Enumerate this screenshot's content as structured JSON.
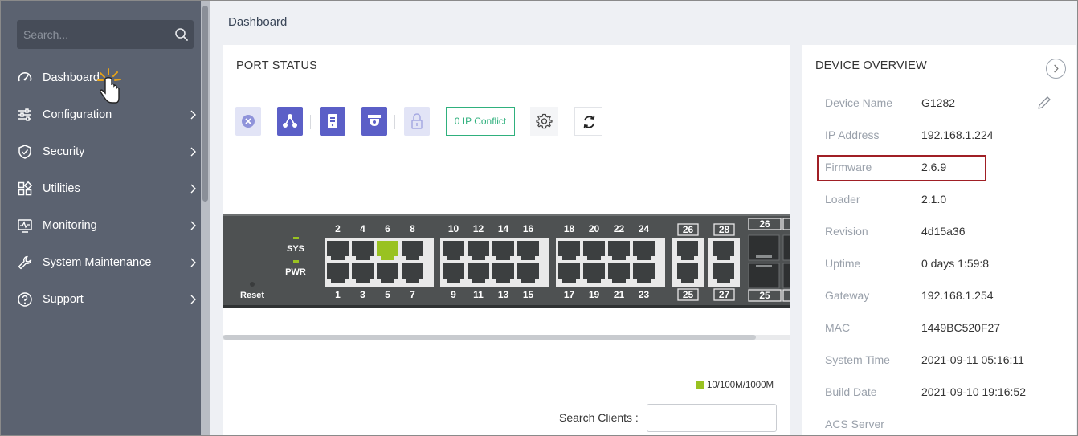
{
  "search": {
    "placeholder": "Search..."
  },
  "nav": [
    {
      "label": "Dashboard",
      "icon": "gauge-icon",
      "has_submenu": false
    },
    {
      "label": "Configuration",
      "icon": "sliders-icon",
      "has_submenu": true
    },
    {
      "label": "Security",
      "icon": "shield-icon",
      "has_submenu": true
    },
    {
      "label": "Utilities",
      "icon": "grid-icon",
      "has_submenu": true
    },
    {
      "label": "Monitoring",
      "icon": "monitor-icon",
      "has_submenu": true
    },
    {
      "label": "System Maintenance",
      "icon": "wrench-icon",
      "has_submenu": true
    },
    {
      "label": "Support",
      "icon": "help-circle-icon",
      "has_submenu": true
    }
  ],
  "breadcrumb": "Dashboard",
  "port_status": {
    "title": "PORT STATUS",
    "toolbar": {
      "ip_conflict_label": "0 IP Conflict"
    },
    "switch": {
      "sys_label": "SYS",
      "pwr_label": "PWR",
      "reset_label": "Reset",
      "top_port_numbers": [
        "2",
        "4",
        "6",
        "8",
        "10",
        "12",
        "14",
        "16",
        "18",
        "20",
        "22",
        "24"
      ],
      "bottom_port_numbers": [
        "1",
        "3",
        "5",
        "7",
        "9",
        "11",
        "13",
        "15",
        "17",
        "19",
        "21",
        "23"
      ],
      "extra_top": [
        "26",
        "28"
      ],
      "extra_bottom": [
        "25",
        "27"
      ],
      "sfp_top": "26",
      "sfp_bottom": "25",
      "active_port": "6"
    },
    "legend_label": "10/100M/1000M",
    "search_clients_label": "Search Clients :"
  },
  "device_overview": {
    "title": "DEVICE OVERVIEW",
    "rows": [
      {
        "key": "Device Name",
        "value": "G1282"
      },
      {
        "key": "IP Address",
        "value": "192.168.1.224"
      },
      {
        "key": "Firmware",
        "value": "2.6.9"
      },
      {
        "key": "Loader",
        "value": "2.1.0"
      },
      {
        "key": "Revision",
        "value": "4d15a36"
      },
      {
        "key": "Uptime",
        "value": "0 days 1:59:8"
      },
      {
        "key": "Gateway",
        "value": "192.168.1.254"
      },
      {
        "key": "MAC",
        "value": "1449BC520F27"
      },
      {
        "key": "System Time",
        "value": "2021-09-11 05:16:11"
      },
      {
        "key": "Build Date",
        "value": "2021-09-10 19:16:52"
      },
      {
        "key": "ACS Server",
        "value": ""
      }
    ]
  },
  "colors": {
    "sidebar": "#5b6270",
    "accent": "#5b5fc7",
    "active_port": "#99c221",
    "highlight_border": "#a01f25",
    "ip_conflict": "#2fb07d"
  }
}
